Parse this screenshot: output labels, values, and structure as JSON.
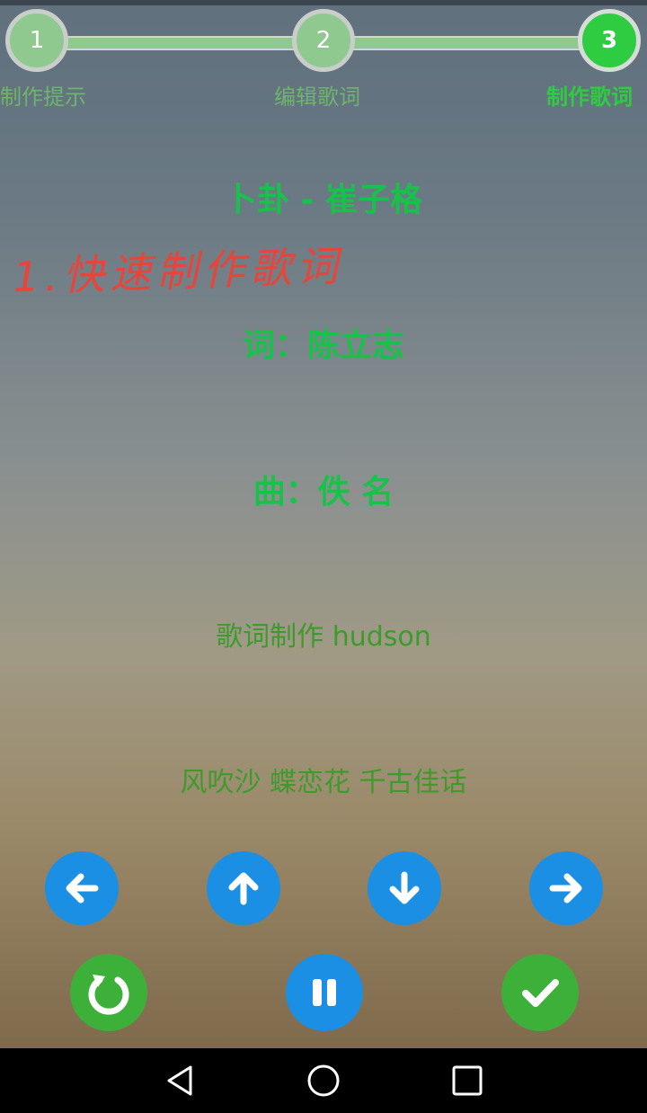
{
  "stepper": {
    "steps": [
      {
        "number": "1",
        "label": "制作提示"
      },
      {
        "number": "2",
        "label": "编辑歌词"
      },
      {
        "number": "3",
        "label": "制作歌词"
      }
    ],
    "active_step": 3,
    "colors": {
      "inactive": "#8fc98f",
      "active": "#2ecc40"
    }
  },
  "lyrics": {
    "title": "卜卦 - 崔子格",
    "annotation": "1.快速制作歌词",
    "lyricist": "词：陈立志",
    "composer": "曲：佚 名",
    "maker": "歌词制作 hudson",
    "line": "风吹沙 蝶恋花 千古佳话"
  },
  "controls": {
    "row1": [
      "arrow-left-icon",
      "arrow-up-icon",
      "arrow-down-icon",
      "arrow-right-icon"
    ],
    "row2": [
      "restart-icon",
      "pause-icon",
      "check-icon"
    ]
  },
  "navbar": [
    "back-icon",
    "home-icon",
    "recents-icon"
  ]
}
